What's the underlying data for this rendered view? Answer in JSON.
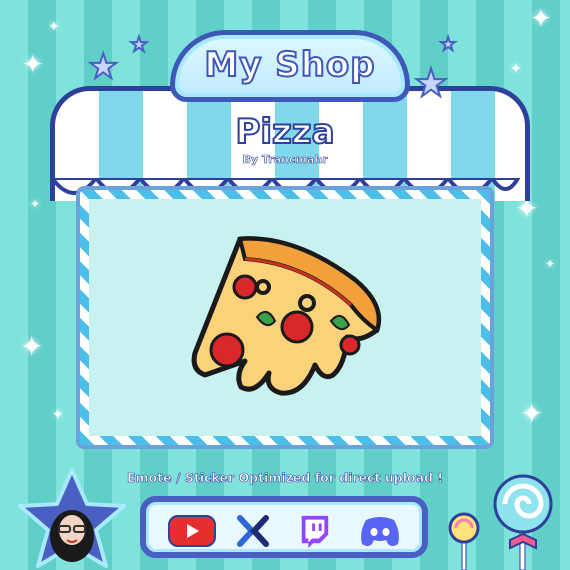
{
  "sign": {
    "title": "My Shop"
  },
  "product": {
    "name": "Pizza",
    "byline": "By Trancmahr"
  },
  "caption": "Emote / Sticker Optimized for direct upload !",
  "social": [
    {
      "name": "youtube-icon",
      "color": "#e62e2e"
    },
    {
      "name": "streamelements-icon",
      "color": "#2f66d8"
    },
    {
      "name": "twitch-icon",
      "color": "#9146ff"
    },
    {
      "name": "discord-icon",
      "color": "#5865f2"
    }
  ],
  "colors": {
    "teal": "#7fe3dc",
    "navy": "#2f3f9c",
    "awning_stripe": "#7fd9ea"
  }
}
